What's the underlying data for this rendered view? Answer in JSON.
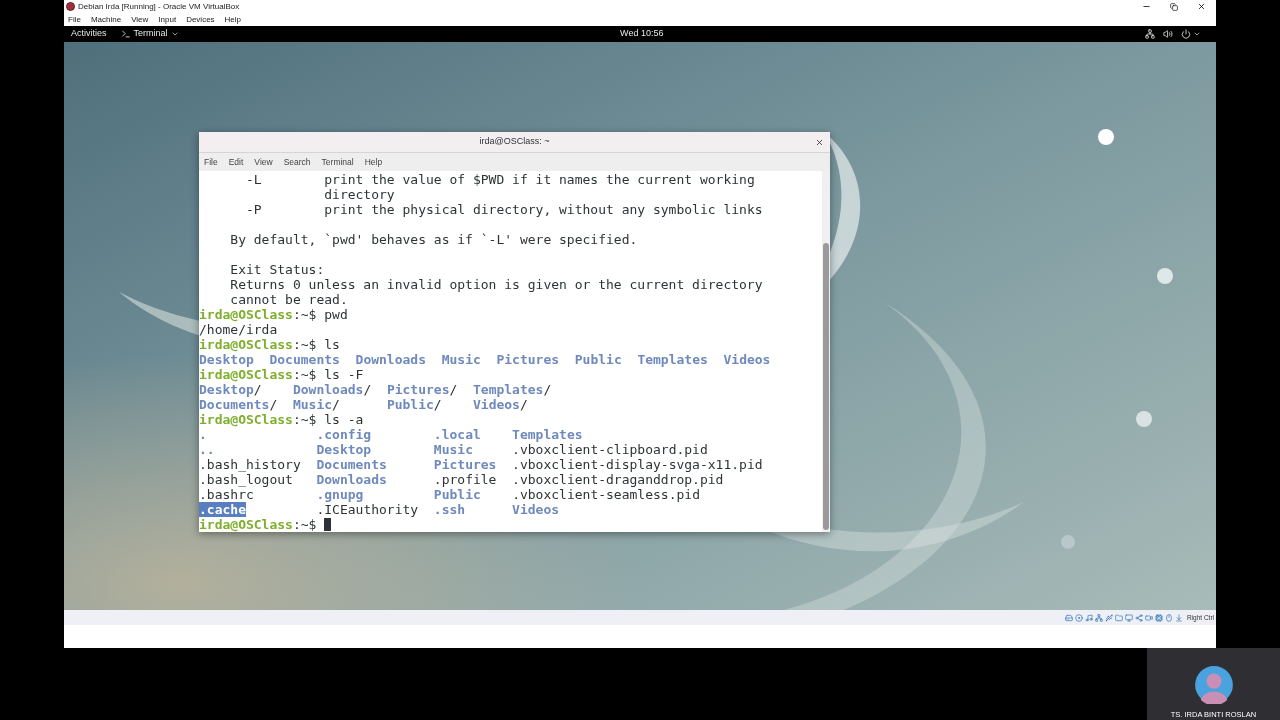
{
  "vbox_window": {
    "title": "Debian Irda [Running] - Oracle VM VirtualBox",
    "menu": [
      "File",
      "Machine",
      "View",
      "Input",
      "Devices",
      "Help"
    ]
  },
  "top_bar": {
    "activities": "Activities",
    "app": "Terminal",
    "clock": "Wed 10:56"
  },
  "terminal": {
    "title": "irda@OSClass: ~",
    "menu": [
      "File",
      "Edit",
      "View",
      "Search",
      "Terminal",
      "Help"
    ],
    "cursor": true,
    "lines": [
      {
        "segs": [
          {
            "kind": "text",
            "text": "      -L        print the value of $PWD if it names the current working"
          }
        ]
      },
      {
        "segs": [
          {
            "kind": "text",
            "text": "                directory"
          }
        ]
      },
      {
        "segs": [
          {
            "kind": "text",
            "text": "      -P        print the physical directory, without any symbolic links"
          }
        ]
      },
      {
        "blank_before": true,
        "segs": [
          {
            "kind": "text",
            "text": "    By default, `pwd' behaves as if `-L' were specified."
          }
        ]
      },
      {
        "blank_before": true,
        "segs": [
          {
            "kind": "text",
            "text": "    Exit Status:"
          }
        ]
      },
      {
        "segs": [
          {
            "kind": "text",
            "text": "    Returns 0 unless an invalid option is given or the current directory"
          }
        ]
      },
      {
        "segs": [
          {
            "kind": "text",
            "text": "    cannot be read."
          }
        ]
      },
      {
        "segs": [
          {
            "kind": "prompt",
            "text": "irda@OSClass"
          },
          {
            "kind": "text",
            "text": ":~$ pwd"
          }
        ]
      },
      {
        "segs": [
          {
            "kind": "text",
            "text": "/home/irda"
          }
        ]
      },
      {
        "segs": [
          {
            "kind": "prompt",
            "text": "irda@OSClass"
          },
          {
            "kind": "text",
            "text": ":~$ ls"
          }
        ]
      },
      {
        "segs": [
          {
            "kind": "dir",
            "text": "Desktop"
          },
          {
            "kind": "dir",
            "text": "  Documents"
          },
          {
            "kind": "dir",
            "text": "  Downloads"
          },
          {
            "kind": "dir",
            "text": "  Music"
          },
          {
            "kind": "dir",
            "text": "  Pictures"
          },
          {
            "kind": "dir",
            "text": "  Public"
          },
          {
            "kind": "dir",
            "text": "  Templates"
          },
          {
            "kind": "dir",
            "text": "  Videos"
          }
        ]
      },
      {
        "segs": [
          {
            "kind": "prompt",
            "text": "irda@OSClass"
          },
          {
            "kind": "text",
            "text": ":~$ ls -F"
          }
        ]
      },
      {
        "segs": [
          {
            "kind": "dir",
            "text": "Desktop"
          },
          {
            "kind": "text",
            "text": "/"
          },
          {
            "kind": "dir",
            "text": "    Downloads"
          },
          {
            "kind": "text",
            "text": "/"
          },
          {
            "kind": "dir",
            "text": "  Pictures"
          },
          {
            "kind": "text",
            "text": "/"
          },
          {
            "kind": "dir",
            "text": "  Templates"
          },
          {
            "kind": "text",
            "text": "/"
          }
        ]
      },
      {
        "segs": [
          {
            "kind": "dir",
            "text": "Documents"
          },
          {
            "kind": "text",
            "text": "/"
          },
          {
            "kind": "dir",
            "text": "  Music"
          },
          {
            "kind": "text",
            "text": "/"
          },
          {
            "kind": "dir",
            "text": "      Public"
          },
          {
            "kind": "text",
            "text": "/"
          },
          {
            "kind": "dir",
            "text": "    Videos"
          },
          {
            "kind": "text",
            "text": "/"
          }
        ]
      },
      {
        "segs": [
          {
            "kind": "prompt",
            "text": "irda@OSClass"
          },
          {
            "kind": "text",
            "text": ":~$ ls -a"
          }
        ]
      },
      {
        "segs": [
          {
            "kind": "dir",
            "text": "."
          },
          {
            "kind": "dir",
            "text": "              .config"
          },
          {
            "kind": "dir",
            "text": "        .local"
          },
          {
            "kind": "dir",
            "text": "    Templates"
          }
        ]
      },
      {
        "segs": [
          {
            "kind": "dir",
            "text": ".."
          },
          {
            "kind": "dir",
            "text": "             Desktop"
          },
          {
            "kind": "dir",
            "text": "        Music"
          },
          {
            "kind": "text",
            "text": "     .vboxclient-clipboard.pid"
          }
        ]
      },
      {
        "segs": [
          {
            "kind": "text",
            "text": ".bash_history"
          },
          {
            "kind": "dir",
            "text": "  Documents"
          },
          {
            "kind": "dir",
            "text": "      Pictures"
          },
          {
            "kind": "text",
            "text": "  .vboxclient-display-svga-x11.pid"
          }
        ]
      },
      {
        "segs": [
          {
            "kind": "text",
            "text": ".bash_logout"
          },
          {
            "kind": "dir",
            "text": "   Downloads"
          },
          {
            "kind": "text",
            "text": "      .profile"
          },
          {
            "kind": "text",
            "text": "  .vboxclient-draganddrop.pid"
          }
        ]
      },
      {
        "segs": [
          {
            "kind": "text",
            "text": ".bashrc"
          },
          {
            "kind": "dir",
            "text": "        .gnupg"
          },
          {
            "kind": "dir",
            "text": "         Public"
          },
          {
            "kind": "text",
            "text": "    .vboxclient-seamless.pid"
          }
        ]
      },
      {
        "segs": [
          {
            "kind": "selected",
            "text": ".cache"
          },
          {
            "kind": "text",
            "text": "         .ICEauthority"
          },
          {
            "kind": "dir",
            "text": "  .ssh"
          },
          {
            "kind": "dir",
            "text": "      Videos"
          }
        ]
      },
      {
        "segs": [
          {
            "kind": "prompt",
            "text": "irda@OSClass"
          },
          {
            "kind": "text",
            "text": ":~$ "
          }
        ]
      }
    ]
  },
  "status_bar": {
    "host_key": "Right Ctrl"
  },
  "participant": {
    "name": "TS. IRDA BINTI ROSLAN"
  }
}
